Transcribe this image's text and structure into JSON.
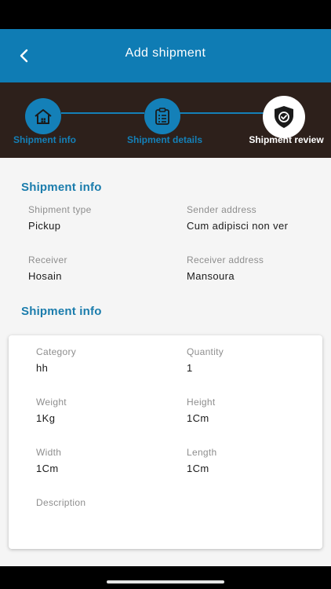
{
  "app_bar": {
    "title": "Add shipment"
  },
  "stepper": {
    "steps": [
      {
        "label": "Shipment info",
        "icon": "home-icon"
      },
      {
        "label": "Shipment details",
        "icon": "clipboard-list-icon"
      },
      {
        "label": "Shipment review",
        "icon": "shield-check-icon"
      }
    ],
    "active_index": 2
  },
  "section1": {
    "title": "Shipment info",
    "fields": [
      {
        "label": "Shipment type",
        "value": "Pickup"
      },
      {
        "label": "Sender address",
        "value": "Cum adipisci non ver"
      },
      {
        "label": "Receiver",
        "value": "Hosain"
      },
      {
        "label": "Receiver address",
        "value": "Mansoura"
      }
    ]
  },
  "section2": {
    "title": "Shipment info",
    "fields": [
      {
        "label": "Category",
        "value": "hh"
      },
      {
        "label": "Quantity",
        "value": "1"
      },
      {
        "label": "Weight",
        "value": "1Kg"
      },
      {
        "label": "Height",
        "value": "1Cm"
      },
      {
        "label": "Width",
        "value": "1Cm"
      },
      {
        "label": "Length",
        "value": "1Cm"
      },
      {
        "label": "Description",
        "value": ""
      }
    ]
  },
  "colors": {
    "primary": "#0f7cb4",
    "stepper_bg": "#2d201b",
    "accent_text": "#1a7cac"
  }
}
